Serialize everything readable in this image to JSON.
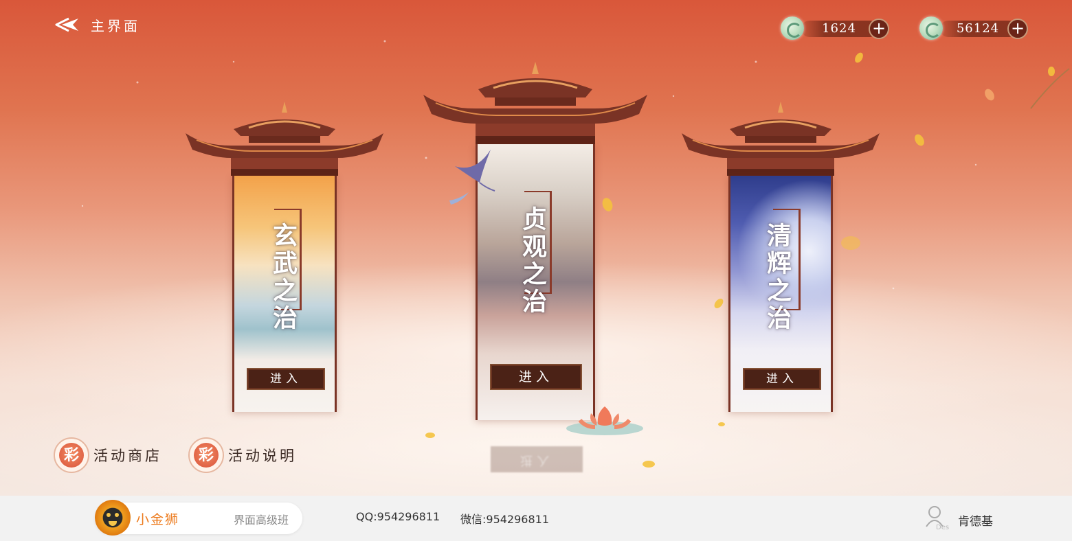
{
  "header": {
    "back_label": "主界面"
  },
  "currencies": [
    {
      "icon": "jade-coin-icon",
      "amount": "1624"
    },
    {
      "icon": "jade-coin-icon",
      "amount": "56124"
    }
  ],
  "portals": [
    {
      "title": "玄武之治",
      "enter_label": "进入"
    },
    {
      "title": "贞观之治",
      "enter_label": "进入"
    },
    {
      "title": "清辉之治",
      "enter_label": "进入"
    }
  ],
  "reflection_text": "进入",
  "activities": [
    {
      "icon": "activity-emblem-icon",
      "label": "活动商店"
    },
    {
      "icon": "activity-emblem-icon",
      "label": "活动说明"
    }
  ],
  "footer": {
    "brand_name": "小金狮",
    "course": "界面高级班",
    "qq": "QQ:954296811",
    "wechat": "微信:954296811",
    "user_badge": "Des",
    "user_name": "肯德基"
  },
  "colors": {
    "sky_top": "#d9573a",
    "roof": "#7a3325",
    "button": "#4b2216",
    "brand_orange": "#ec7a1c"
  }
}
